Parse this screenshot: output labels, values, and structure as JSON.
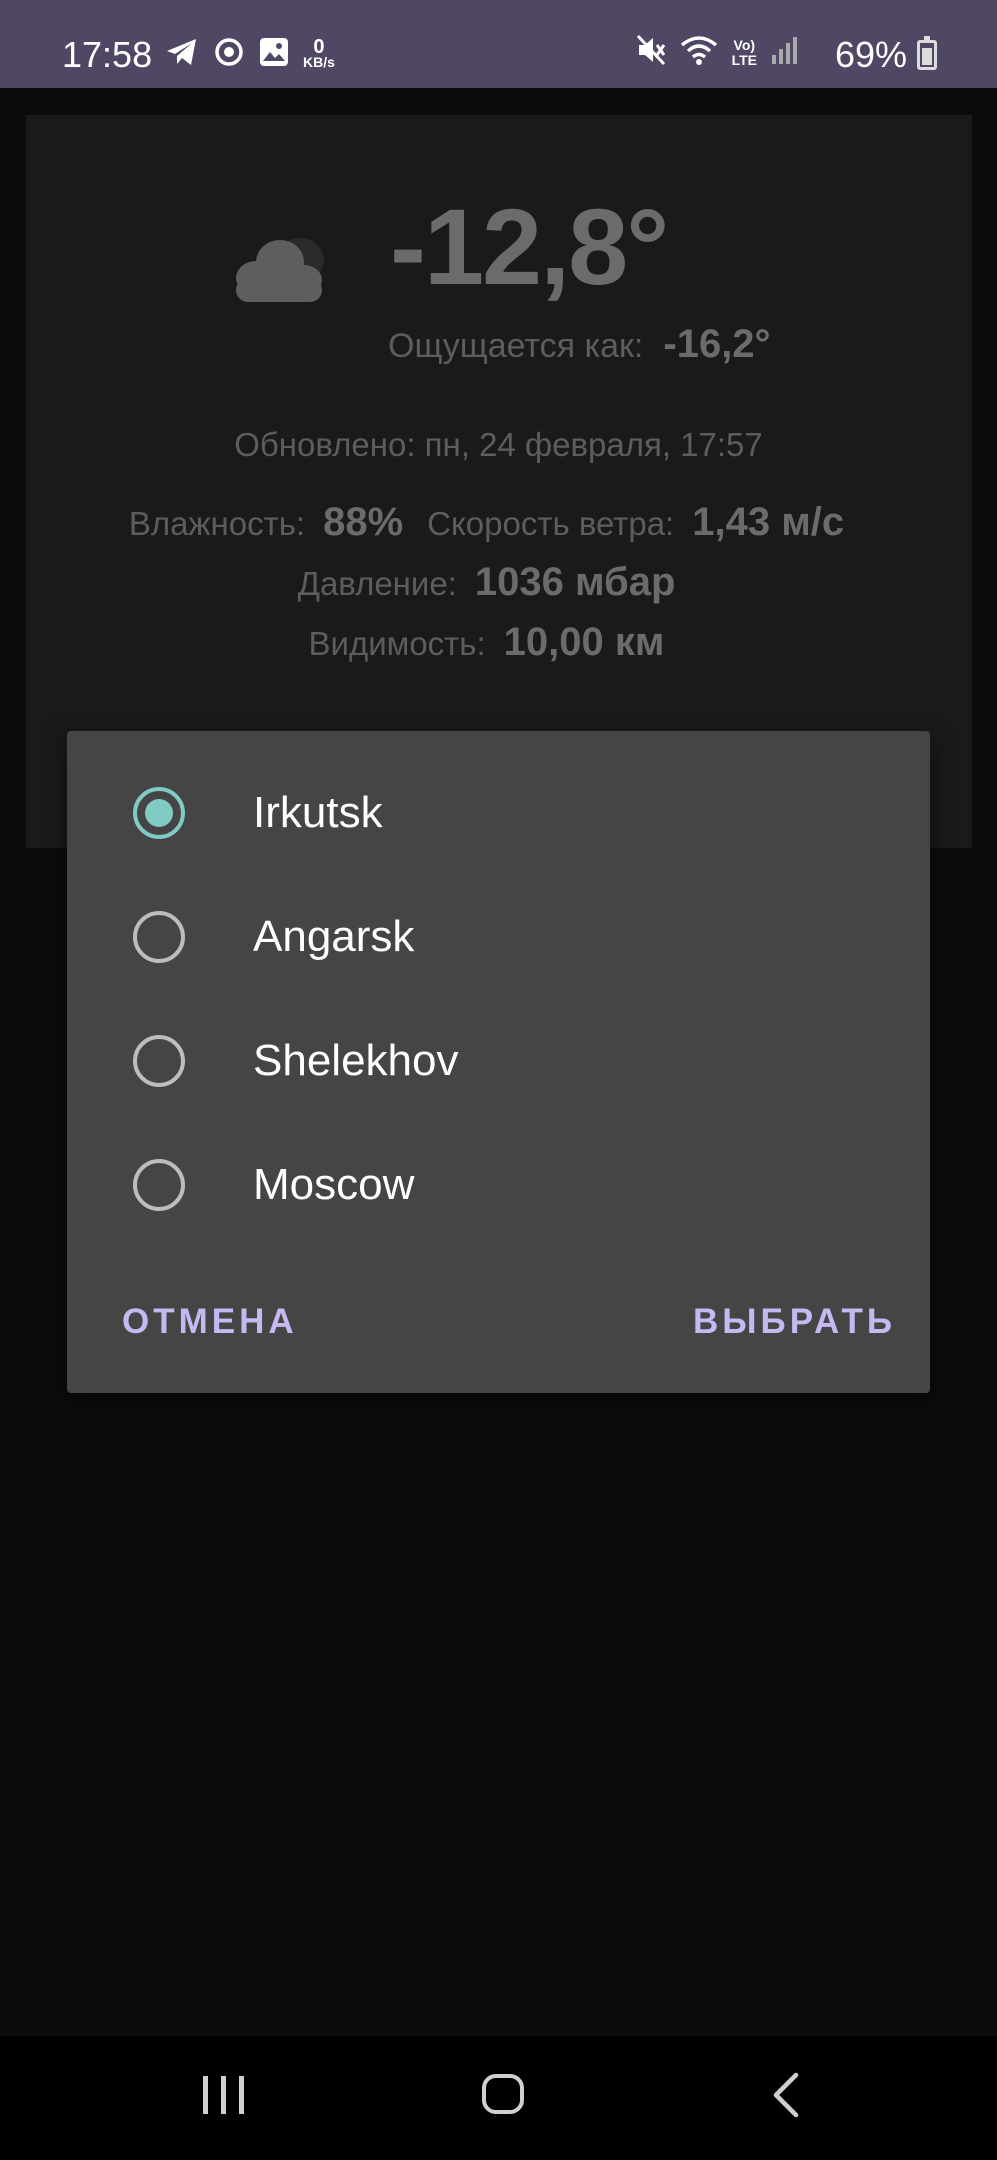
{
  "status_bar": {
    "time": "17:58",
    "network_speed_value": "0",
    "network_speed_unit": "KB/s",
    "volte_label_top": "Vo)",
    "volte_label_bottom": "LTE",
    "battery_percent": "69%",
    "icons_left": [
      "telegram-icon",
      "sync-icon",
      "gallery-icon"
    ],
    "icons_right": [
      "mute-icon",
      "wifi-icon",
      "volte-icon",
      "signal-icon",
      "battery-icon"
    ]
  },
  "weather": {
    "temperature": "-12,8°",
    "feels_like_label": "Ощущается как:",
    "feels_like_value": "-16,2°",
    "updated_label": "Обновлено:",
    "updated_value": "пн, 24 февраля, 17:57",
    "humidity_label": "Влажность:",
    "humidity_value": "88%",
    "wind_label": "Скорость ветра:",
    "wind_value": "1,43 м/с",
    "pressure_label": "Давление:",
    "pressure_value": "1036 мбар",
    "visibility_label": "Видимость:",
    "visibility_value": "10,00 км",
    "condition_icon": "cloud-icon"
  },
  "dialog": {
    "options": [
      {
        "label": "Irkutsk",
        "selected": true
      },
      {
        "label": "Angarsk",
        "selected": false
      },
      {
        "label": "Shelekhov",
        "selected": false
      },
      {
        "label": "Moscow",
        "selected": false
      }
    ],
    "cancel_label": "ОТМЕНА",
    "confirm_label": "ВЫБРАТЬ",
    "accent_color": "#80cbc4",
    "button_color": "#c6b8f0"
  },
  "colors": {
    "status_bar": "#4f4763",
    "background": "#0c0c0e",
    "dialog": "#454545"
  }
}
